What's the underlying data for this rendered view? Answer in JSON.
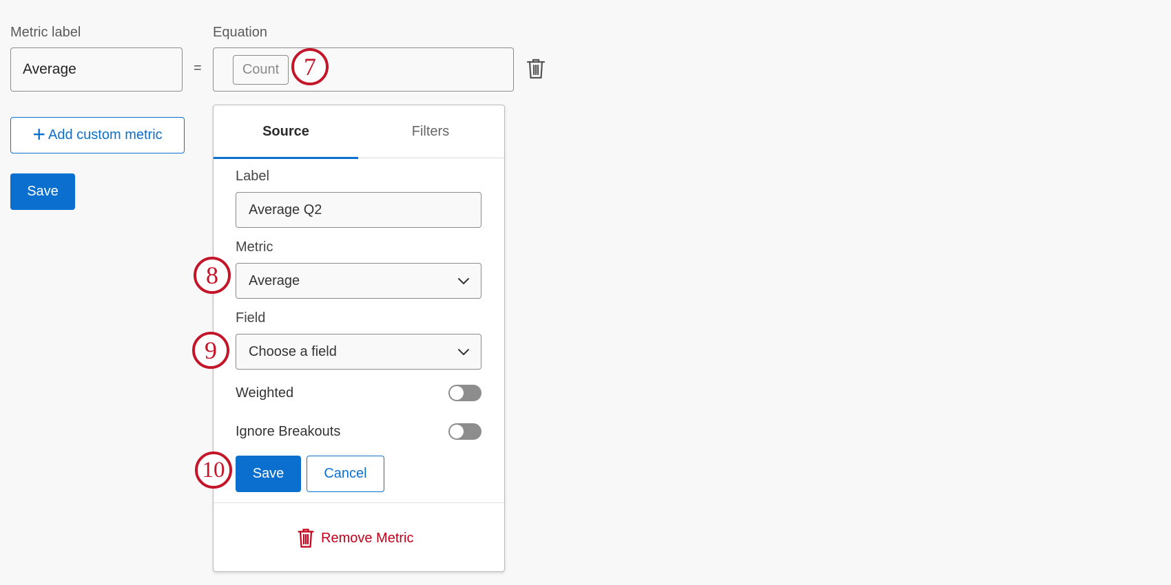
{
  "form": {
    "metric_label_heading": "Metric label",
    "equation_heading": "Equation",
    "metric_label_value": "Average",
    "equals_sign": "=",
    "equation_chip": "Count",
    "add_custom_metric": "Add custom metric",
    "save": "Save"
  },
  "steps": [
    "7",
    "8",
    "9",
    "10"
  ],
  "panel": {
    "tabs": [
      {
        "label": "Source",
        "active": true
      },
      {
        "label": "Filters",
        "active": false
      }
    ],
    "label_heading": "Label",
    "label_value": "Average Q2",
    "metric_heading": "Metric",
    "metric_value": "Average",
    "field_heading": "Field",
    "field_value": "Choose a field",
    "weighted_label": "Weighted",
    "weighted_on": false,
    "ignore_breakouts_label": "Ignore Breakouts",
    "ignore_breakouts_on": false,
    "save": "Save",
    "cancel": "Cancel",
    "remove_metric": "Remove Metric"
  },
  "icons": {
    "delete": "trash-icon",
    "add": "plus-icon",
    "dropdown": "chevron-down-icon"
  },
  "colors": {
    "primary": "#0b6fcf",
    "annotation": "#c4162a",
    "danger": "#c4001a",
    "toggle_off": "#8d8d8d"
  }
}
